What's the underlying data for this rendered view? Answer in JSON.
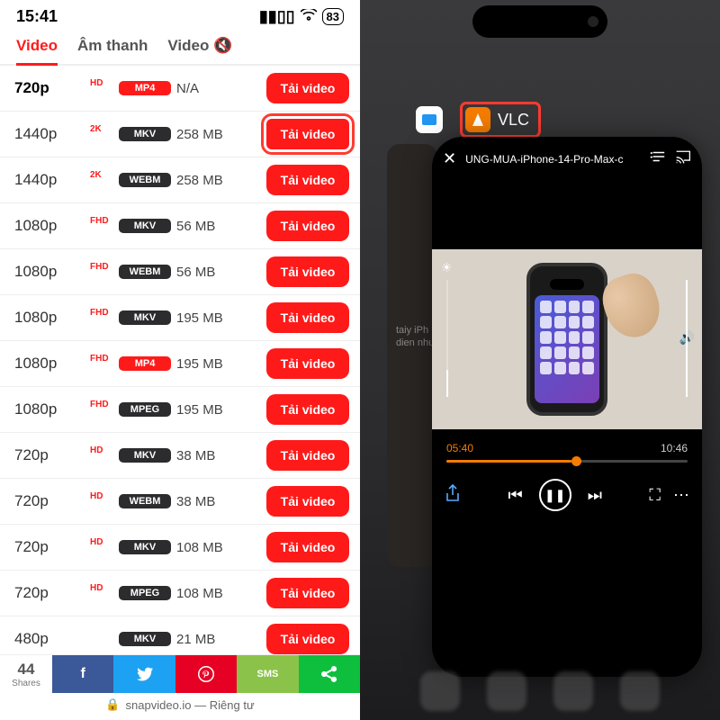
{
  "status": {
    "time": "15:41",
    "battery": "83"
  },
  "tabs": {
    "video": "Video",
    "audio": "Âm thanh",
    "muted": "Video"
  },
  "download_label": "Tải video",
  "rows": [
    {
      "res": "720p",
      "bold": true,
      "qual": "HD",
      "fmt": "MP4",
      "fmtStyle": "red",
      "size": "N/A",
      "highlight": false
    },
    {
      "res": "1440p",
      "bold": false,
      "qual": "2K",
      "fmt": "MKV",
      "fmtStyle": "dark",
      "size": "258 MB",
      "highlight": true
    },
    {
      "res": "1440p",
      "bold": false,
      "qual": "2K",
      "fmt": "WEBM",
      "fmtStyle": "dark",
      "size": "258 MB",
      "highlight": false
    },
    {
      "res": "1080p",
      "bold": false,
      "qual": "FHD",
      "fmt": "MKV",
      "fmtStyle": "dark",
      "size": "56 MB",
      "highlight": false
    },
    {
      "res": "1080p",
      "bold": false,
      "qual": "FHD",
      "fmt": "WEBM",
      "fmtStyle": "dark",
      "size": "56 MB",
      "highlight": false
    },
    {
      "res": "1080p",
      "bold": false,
      "qual": "FHD",
      "fmt": "MKV",
      "fmtStyle": "dark",
      "size": "195 MB",
      "highlight": false
    },
    {
      "res": "1080p",
      "bold": false,
      "qual": "FHD",
      "fmt": "MP4",
      "fmtStyle": "red",
      "size": "195 MB",
      "highlight": false
    },
    {
      "res": "1080p",
      "bold": false,
      "qual": "FHD",
      "fmt": "MPEG",
      "fmtStyle": "dark",
      "size": "195 MB",
      "highlight": false
    },
    {
      "res": "720p",
      "bold": false,
      "qual": "HD",
      "fmt": "MKV",
      "fmtStyle": "dark",
      "size": "38 MB",
      "highlight": false
    },
    {
      "res": "720p",
      "bold": false,
      "qual": "HD",
      "fmt": "WEBM",
      "fmtStyle": "dark",
      "size": "38 MB",
      "highlight": false
    },
    {
      "res": "720p",
      "bold": false,
      "qual": "HD",
      "fmt": "MKV",
      "fmtStyle": "dark",
      "size": "108 MB",
      "highlight": false
    },
    {
      "res": "720p",
      "bold": false,
      "qual": "HD",
      "fmt": "MPEG",
      "fmtStyle": "dark",
      "size": "108 MB",
      "highlight": false
    },
    {
      "res": "480p",
      "bold": false,
      "qual": "",
      "fmt": "MKV",
      "fmtStyle": "dark",
      "size": "21 MB",
      "highlight": false
    }
  ],
  "share": {
    "count": "44",
    "label": "Shares",
    "sms": "SMS"
  },
  "url": {
    "lock": "🔒",
    "domain": "snapvideo.io — Riêng tư"
  },
  "right": {
    "app_name": "VLC",
    "video_title": "UNG-MUA-iPhone-14-Pro-Max-c",
    "bg_text": "taiy\niPh\ndien\nnhu",
    "current_time": "05:40",
    "duration": "10:46"
  }
}
